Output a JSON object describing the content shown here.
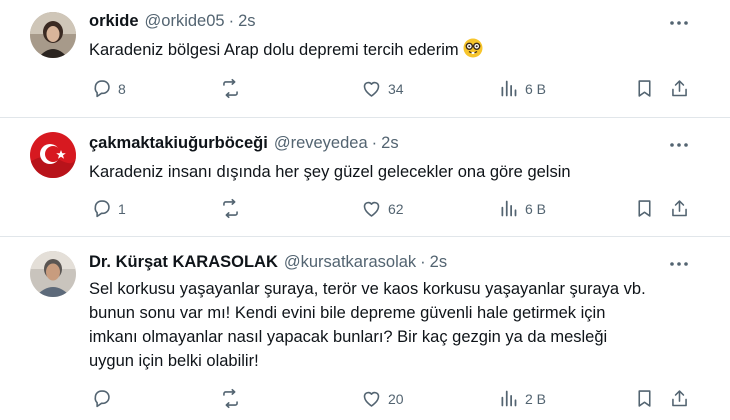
{
  "tweets": [
    {
      "name": "orkide",
      "handle": "@orkide05",
      "dot": "·",
      "time": "2s",
      "text": "Karadeniz bölgesi Arap dolu depremi tercih ederim",
      "emoji": "nerd-face",
      "replies": "8",
      "retweets": "",
      "likes": "34",
      "views": "6 B"
    },
    {
      "name": "çakmaktakiuğurböceği",
      "handle": "@reveyedea",
      "dot": "·",
      "time": "2s",
      "text": "Karadeniz insanı dışında her şey güzel gelecekler ona göre gelsin",
      "replies": "1",
      "retweets": "",
      "likes": "62",
      "views": "6 B"
    },
    {
      "name": "Dr. Kürşat KARASOLAK",
      "handle": "@kursatkarasolak",
      "dot": "·",
      "time": "2s",
      "text_lines": [
        "Sel korkusu yaşayanlar şuraya, terör ve kaos korkusu yaşayanlar şuraya vb.",
        "bunun sonu var mı! Kendi evini bile depreme güvenli hale getirmek için",
        "imkanı olmayanlar nasıl yapacak bunları? Bir kaç gezgin  ya da mesleği",
        "uygun için belki olabilir!"
      ],
      "replies": "",
      "retweets": "",
      "likes": "20",
      "views": "2 B"
    }
  ],
  "icons": {
    "reply": "reply-icon",
    "retweet": "retweet-icon",
    "like": "heart-icon",
    "views": "views-icon",
    "bookmark": "bookmark-icon",
    "share": "share-icon",
    "more": "more-icon"
  },
  "colors": {
    "text": "#0f1419",
    "secondary": "#536471",
    "divider": "#e1e6ea"
  }
}
